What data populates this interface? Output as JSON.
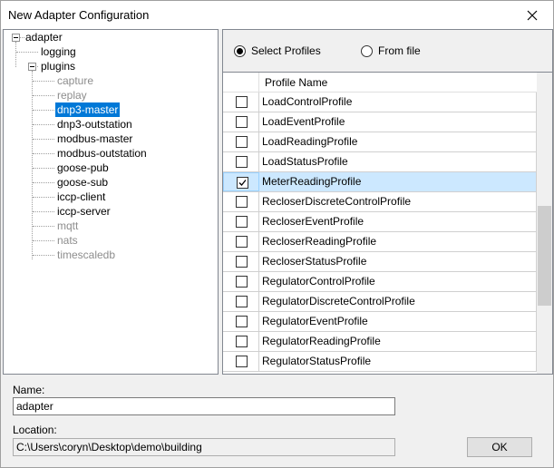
{
  "window": {
    "title": "New Adapter Configuration",
    "close_icon": "close-icon"
  },
  "tree": {
    "root": "adapter",
    "logging": "logging",
    "plugins": "plugins",
    "plugin_items": [
      {
        "label": "capture",
        "enabled": false
      },
      {
        "label": "replay",
        "enabled": false
      },
      {
        "label": "dnp3-master",
        "enabled": true,
        "selected": true
      },
      {
        "label": "dnp3-outstation",
        "enabled": true
      },
      {
        "label": "modbus-master",
        "enabled": true
      },
      {
        "label": "modbus-outstation",
        "enabled": true
      },
      {
        "label": "goose-pub",
        "enabled": true
      },
      {
        "label": "goose-sub",
        "enabled": true
      },
      {
        "label": "iccp-client",
        "enabled": true
      },
      {
        "label": "iccp-server",
        "enabled": true
      },
      {
        "label": "mqtt",
        "enabled": false
      },
      {
        "label": "nats",
        "enabled": false
      },
      {
        "label": "timescaledb",
        "enabled": false
      }
    ]
  },
  "profiles_source": {
    "select_profiles": "Select Profiles",
    "from_file": "From file",
    "selected": "select_profiles"
  },
  "grid": {
    "header": "Profile Name",
    "rows": [
      {
        "name": "LoadControlProfile",
        "checked": false
      },
      {
        "name": "LoadEventProfile",
        "checked": false
      },
      {
        "name": "LoadReadingProfile",
        "checked": false
      },
      {
        "name": "LoadStatusProfile",
        "checked": false
      },
      {
        "name": "MeterReadingProfile",
        "checked": true
      },
      {
        "name": "RecloserDiscreteControlProfile",
        "checked": false
      },
      {
        "name": "RecloserEventProfile",
        "checked": false
      },
      {
        "name": "RecloserReadingProfile",
        "checked": false
      },
      {
        "name": "RecloserStatusProfile",
        "checked": false
      },
      {
        "name": "RegulatorControlProfile",
        "checked": false
      },
      {
        "name": "RegulatorDiscreteControlProfile",
        "checked": false
      },
      {
        "name": "RegulatorEventProfile",
        "checked": false
      },
      {
        "name": "RegulatorReadingProfile",
        "checked": false
      },
      {
        "name": "RegulatorStatusProfile",
        "checked": false
      }
    ]
  },
  "form": {
    "name_label": "Name:",
    "name_value": "adapter",
    "location_label": "Location:",
    "location_value": "C:\\Users\\coryn\\Desktop\\demo\\building",
    "ok_label": "OK"
  },
  "colors": {
    "selection": "#0078d7",
    "row_highlight": "#cce8ff",
    "disabled_text": "#8d8d8d"
  }
}
